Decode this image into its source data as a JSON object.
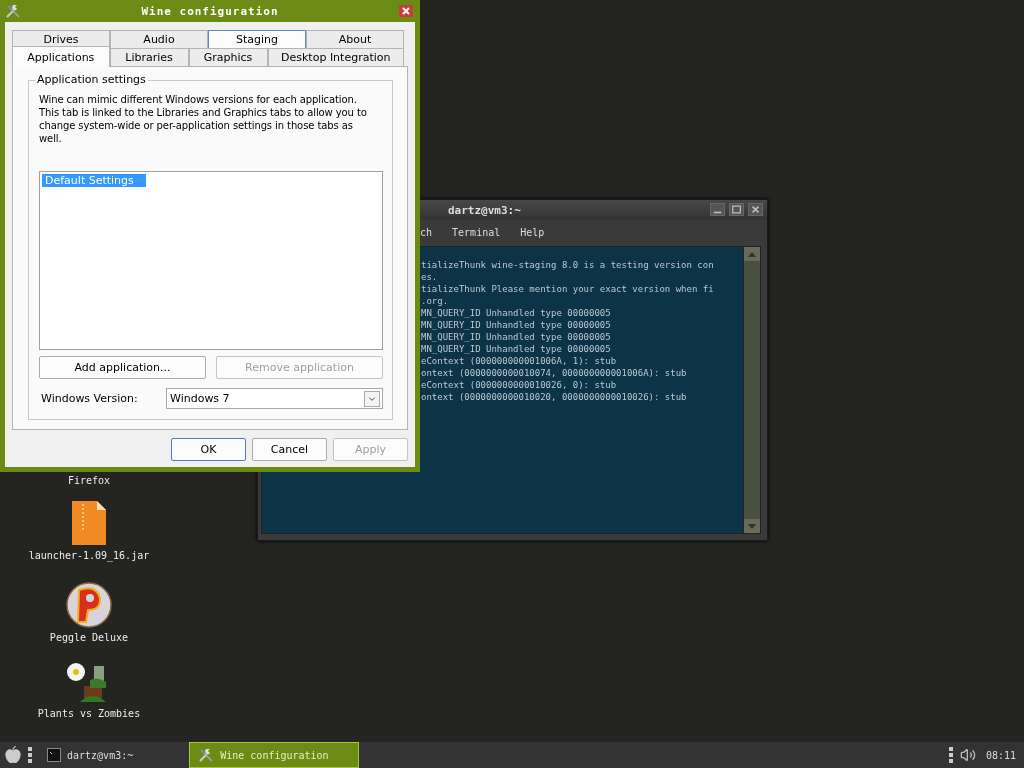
{
  "desktop_icons": [
    {
      "label": "Firefox",
      "kind": "covered"
    },
    {
      "label": "launcher-1.09_16.jar",
      "kind": "archive"
    },
    {
      "label": "Peggle Deluxe",
      "kind": "ball"
    },
    {
      "label": "Plants vs Zombies",
      "kind": "plant"
    }
  ],
  "terminal": {
    "title": "dartz@vm3:~",
    "menu": [
      "ch",
      "Terminal",
      "Help"
    ],
    "lines": [
      "tializeThunk wine-staging 8.0 is a testing version con",
      "es.",
      "tializeThunk Please mention your exact version when fi",
      ".org.",
      "MN_QUERY_ID Unhandled type 00000005",
      "MN_QUERY_ID Unhandled type 00000005",
      "MN_QUERY_ID Unhandled type 00000005",
      "MN_QUERY_ID Unhandled type 00000005",
      "eContext (000000000001006A, 1): stub",
      "ontext (0000000000010074, 000000000001006A): stub",
      "eContext (0000000000010026, 0): stub",
      "ontext (0000000000010020, 0000000000010026): stub"
    ]
  },
  "wine": {
    "title": "Wine configuration",
    "tabs_row1": [
      {
        "label": "Drives",
        "selected": false,
        "hot": false
      },
      {
        "label": "Audio",
        "selected": false,
        "hot": false
      },
      {
        "label": "Staging",
        "selected": false,
        "hot": true
      },
      {
        "label": "About",
        "selected": false,
        "hot": false
      }
    ],
    "tabs_row2": [
      {
        "label": "Applications",
        "selected": true,
        "hot": false
      },
      {
        "label": "Libraries",
        "selected": false,
        "hot": false
      },
      {
        "label": "Graphics",
        "selected": false,
        "hot": false
      },
      {
        "label": "Desktop Integration",
        "selected": false,
        "hot": false
      }
    ],
    "group_title": "Application settings",
    "description": "Wine can mimic different Windows versions for each application. This tab is linked to the Libraries and Graphics tabs to allow you to change system-wide or per-application settings in those tabs as well.",
    "list_items": [
      {
        "label": "Default Settings",
        "selected": true
      }
    ],
    "buttons": [
      {
        "label": "Add application...",
        "disabled": false
      },
      {
        "label": "Remove application",
        "disabled": true
      }
    ],
    "version_label": "Windows Version:",
    "version_value": "Windows 7",
    "dialog_buttons": [
      {
        "label": "OK",
        "default": true,
        "disabled": false
      },
      {
        "label": "Cancel",
        "default": false,
        "disabled": false
      },
      {
        "label": "Apply",
        "default": false,
        "disabled": true
      }
    ]
  },
  "taskbar": {
    "items": [
      {
        "label": "dartz@vm3:~",
        "kind": "terminal",
        "selected": false
      },
      {
        "label": "Wine configuration",
        "kind": "wine",
        "selected": true
      }
    ],
    "clock": "08:11"
  }
}
